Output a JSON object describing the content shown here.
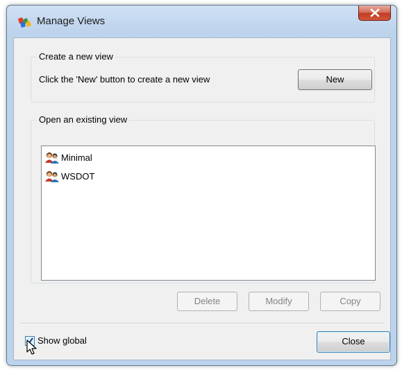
{
  "window": {
    "title": "Manage Views",
    "close_icon": "close-x-icon"
  },
  "create_group": {
    "legend": "Create a new view",
    "instruction": "Click the 'New' button to create a new view",
    "new_button": "New"
  },
  "existing_group": {
    "legend": "Open an existing view",
    "views": [
      {
        "label": "Minimal",
        "icon": "user-view-icon"
      },
      {
        "label": "WSDOT",
        "icon": "user-view-icon"
      }
    ],
    "delete_button": "Delete",
    "modify_button": "Modify",
    "copy_button": "Copy"
  },
  "footer": {
    "show_global_label": "Show global",
    "show_global_checked": true,
    "close_button": "Close"
  },
  "colors": {
    "window_frame": "#bcd3ec",
    "close_red": "#c13b22",
    "client_bg": "#f0f0f0"
  }
}
